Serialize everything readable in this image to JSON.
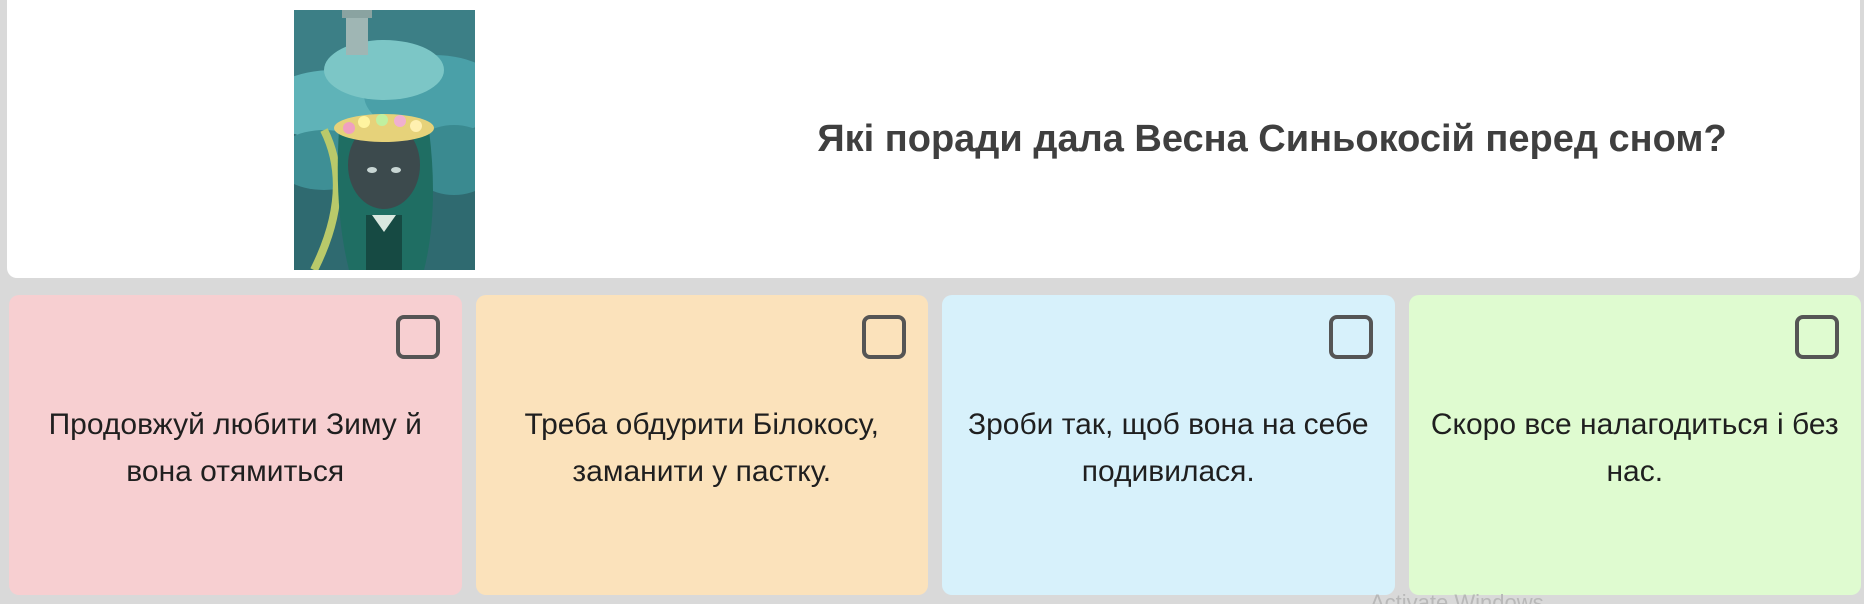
{
  "question": {
    "text": "Які поради дала Весна Синьокосій перед сном?"
  },
  "illustration": {
    "icon": "girl-with-flower-crown-illustration"
  },
  "answers": [
    {
      "text": "Продовжуй любити Зиму й вона отямиться",
      "color": "#f7cfd1"
    },
    {
      "text": "Треба обдурити Білокосу, заманити у пастку.",
      "color": "#fbe2bb"
    },
    {
      "text": "Зроби так, щоб вона на себе подивилася.",
      "color": "#d7f1fb"
    },
    {
      "text": "Скоро все налагодиться і без нас.",
      "color": "#dffbd0"
    }
  ],
  "watermark": {
    "text": "Activate Windows"
  }
}
